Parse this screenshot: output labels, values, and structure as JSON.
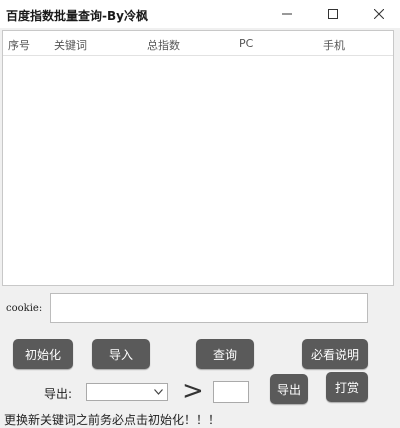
{
  "window": {
    "title": "百度指数批量查询-By冷枫"
  },
  "table": {
    "columns": [
      "序号",
      "关键词",
      "总指数",
      "PC",
      "手机"
    ],
    "rows": []
  },
  "cookie": {
    "label": "cookie:",
    "value": ""
  },
  "buttons": {
    "init": "初始化",
    "import": "导入",
    "query": "查询",
    "readme": "必看说明",
    "export": "导出",
    "reward": "打赏"
  },
  "export": {
    "label": "导出:",
    "selected": "",
    "operator": ">",
    "threshold": ""
  },
  "notice": "更换新关键词之前务必点击初始化！！！"
}
